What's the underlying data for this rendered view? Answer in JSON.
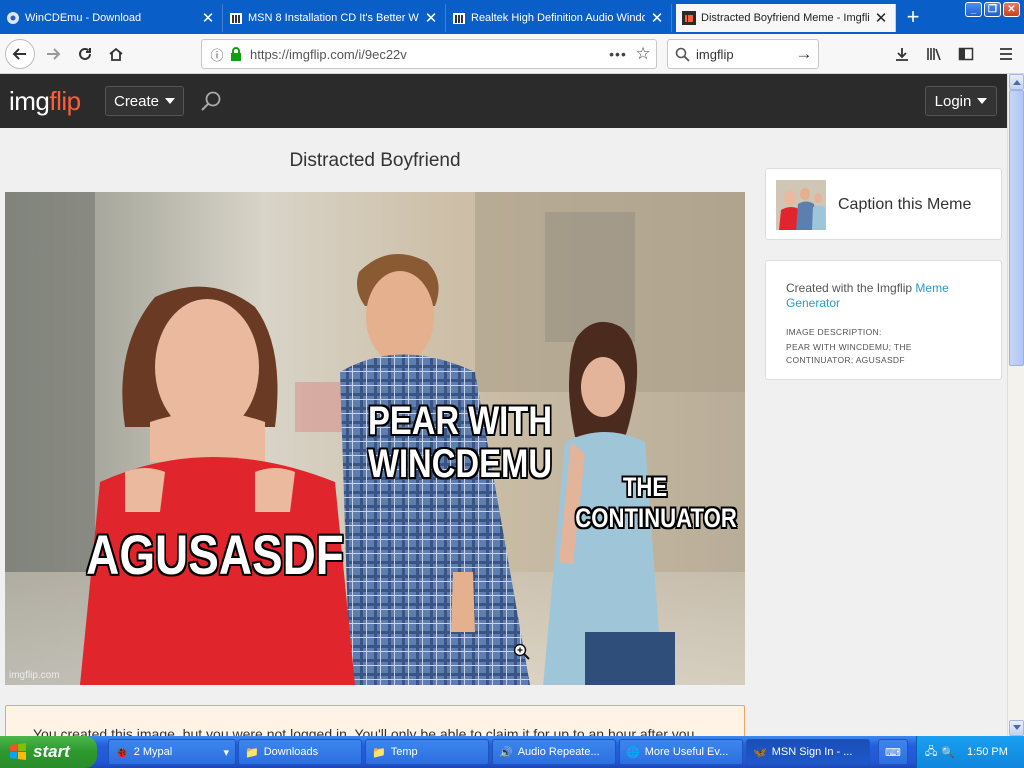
{
  "tabs": [
    {
      "title": "WinCDEmu - Download",
      "icon": "gear-icon"
    },
    {
      "title": "MSN 8 Installation CD It's Better W",
      "icon": "archive-icon"
    },
    {
      "title": "Realtek High Definition Audio Windo",
      "icon": "archive-icon"
    },
    {
      "title": "Distracted Boyfriend Meme - Imgflip",
      "icon": "imgflip-icon",
      "active": true
    }
  ],
  "tab_close_glyph": "✕",
  "new_tab_glyph": "+",
  "window_buttons": [
    "_",
    "❐",
    "✕"
  ],
  "address_bar": {
    "url": "https://imgflip.com/i/9ec22v"
  },
  "search_box": {
    "text": "imgflip"
  },
  "site": {
    "logo_part1": "img",
    "logo_part2": "flip",
    "create_label": "Create",
    "login_label": "Login"
  },
  "page": {
    "title": "Distracted Boyfriend",
    "captions": {
      "left": "AGUSASDF",
      "middle": "PEAR WITH WINCDEMU",
      "right": "THE CONTINUATOR"
    },
    "watermark": "imgflip.com",
    "notice": "You created this image, but you were not logged in. You'll only be able to claim it for up to an hour after you"
  },
  "sidebar": {
    "caption_card_label": "Caption this Meme",
    "created_with": "Created with the Imgflip ",
    "created_link": "Meme Generator",
    "desc_label": "IMAGE DESCRIPTION:",
    "desc_text": "PEAR WITH WINCDEMU; THE CONTINUATOR; AGUSASDF"
  },
  "taskbar": {
    "start_label": "start",
    "tasks": [
      {
        "label": "2 Mypal"
      },
      {
        "label": "Downloads"
      },
      {
        "label": "Temp"
      },
      {
        "label": "Audio Repeate..."
      },
      {
        "label": "More Useful Ev..."
      },
      {
        "label": "MSN Sign In - ..."
      }
    ],
    "clock": "1:50 PM"
  },
  "colors": {
    "tab_strip": "#0a5ec8",
    "site_header": "#2b2b2b",
    "logo_accent": "#ff5e3a",
    "link": "#2a9ccc",
    "notice_border": "#f0a36a",
    "taskbar": "#245edc",
    "start_green": "#3aa63a"
  }
}
